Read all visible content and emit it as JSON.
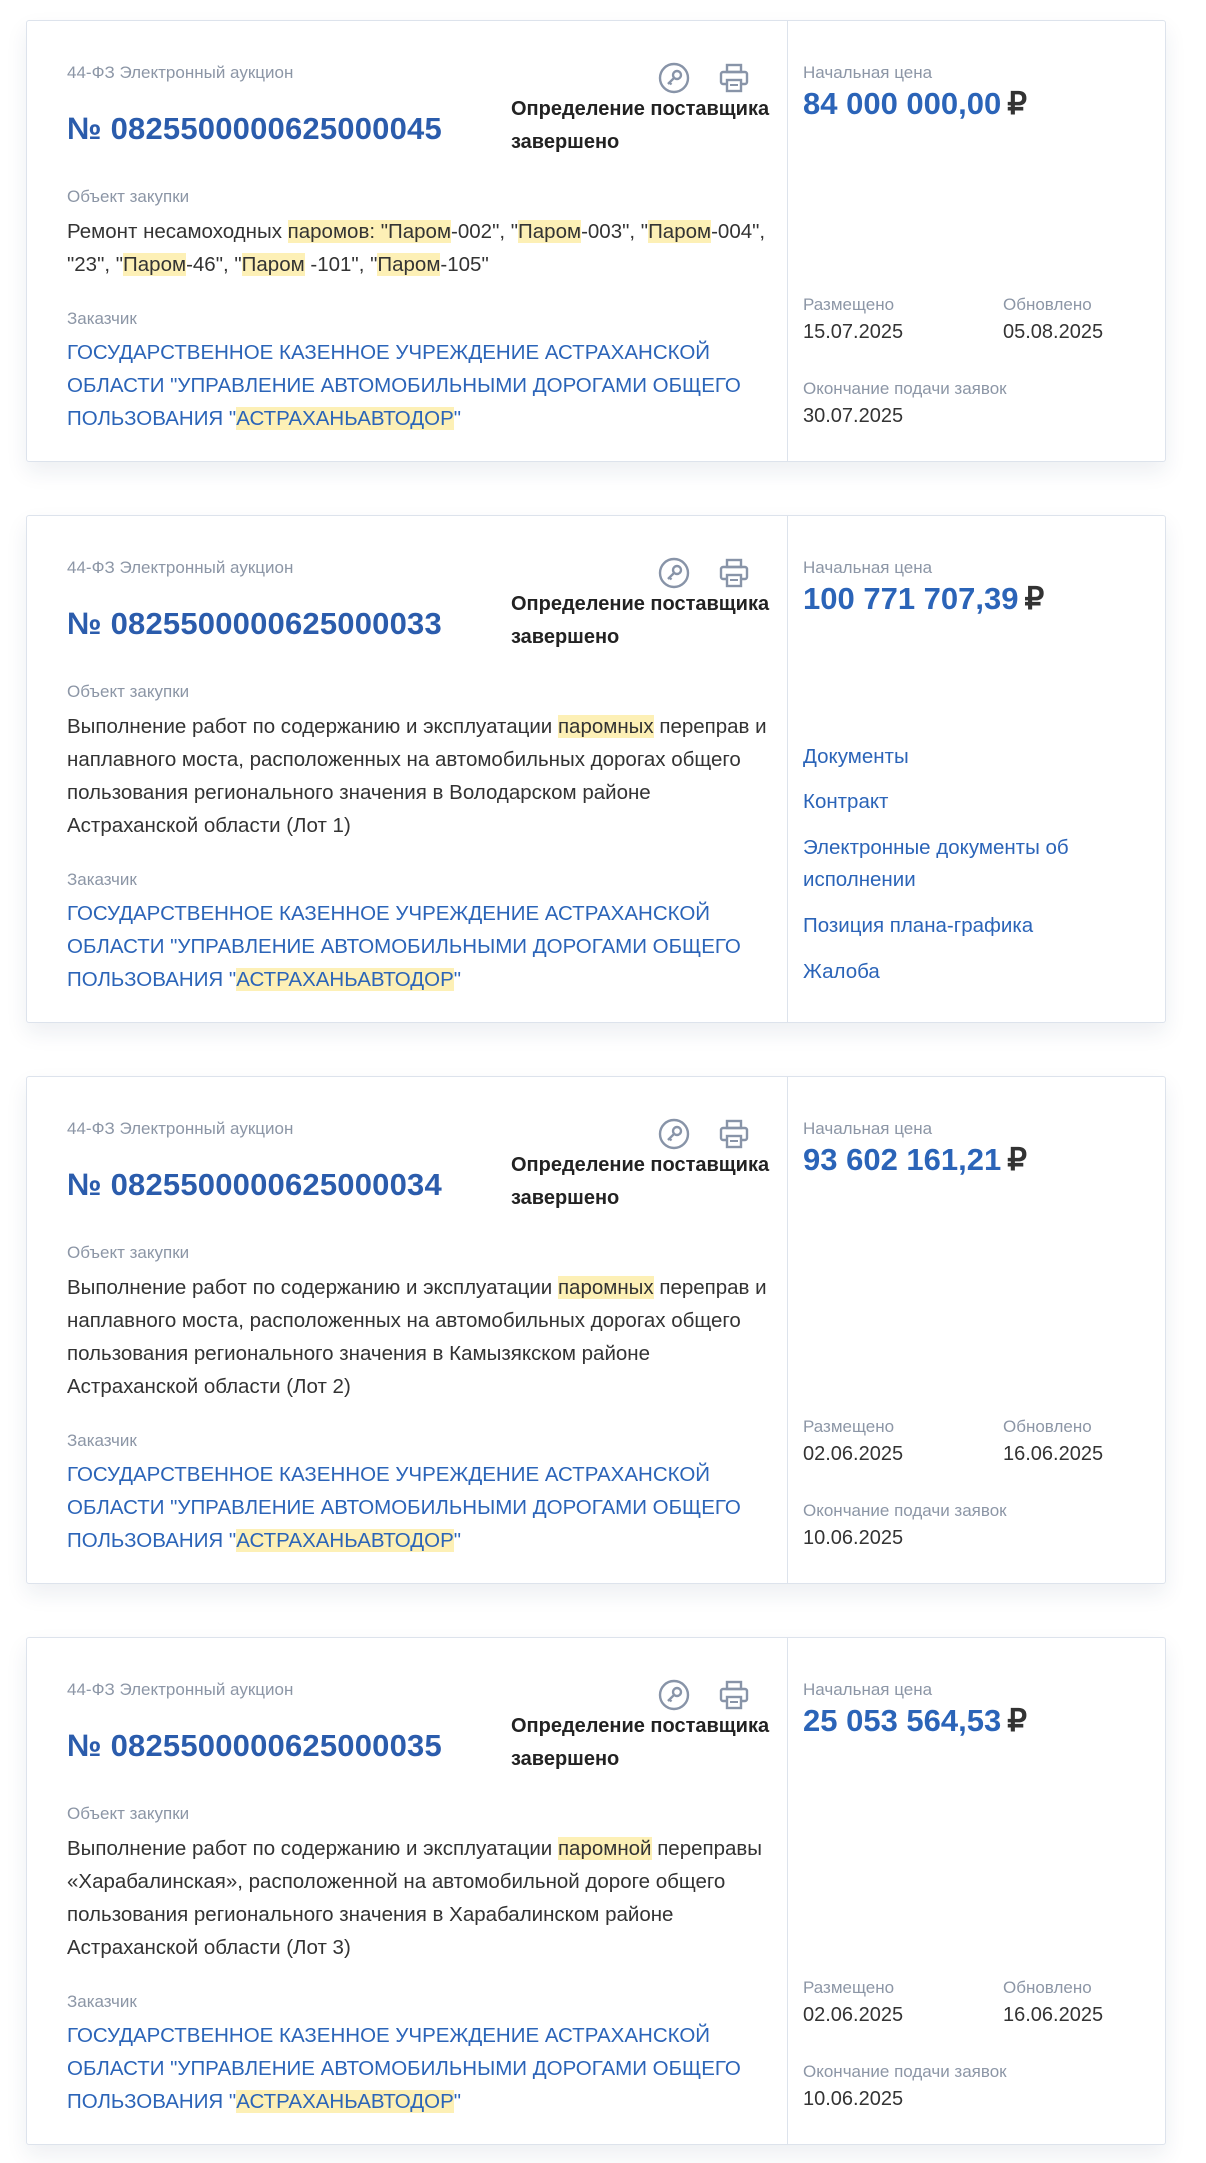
{
  "labels": {
    "object": "Объект закупки",
    "customer": "Заказчик",
    "start_price": "Начальная цена",
    "placed": "Размещено",
    "updated": "Обновлено",
    "deadline": "Окончание подачи заявок",
    "currency": "₽",
    "customer_prefix": "ГОСУДАРСТВЕННОЕ КАЗЕННОЕ УЧРЕЖДЕНИЕ АСТРАХАНСКОЙ ОБЛАСТИ \"УПРАВЛЕНИЕ АВТОМОБИЛЬНЫМИ ДОРОГАМИ ОБЩЕГО ПОЛЬЗОВАНИЯ \"",
    "customer_highlight": "АСТРАХАНЬАВТОДОР",
    "customer_suffix": "\""
  },
  "cards": [
    {
      "type": "44-ФЗ Электронный аукцион",
      "number": "№ 0825500000625000045",
      "status": "Определение поставщика завершено",
      "price": "84 000 000,00",
      "placed": "15.07.2025",
      "updated": "05.08.2025",
      "deadline": "30.07.2025",
      "object_parts": [
        {
          "t": "Ремонт несамоходных "
        },
        {
          "t": "паромов: \"Паром",
          "h": true
        },
        {
          "t": "-002\", \""
        },
        {
          "t": "Паром",
          "h": true
        },
        {
          "t": "-003\", \""
        },
        {
          "t": "Паром",
          "h": true
        },
        {
          "t": "-004\", \"23\", \""
        },
        {
          "t": "Паром",
          "h": true
        },
        {
          "t": "-46\", \""
        },
        {
          "t": "Паром",
          "h": true
        },
        {
          "t": " -101\", \""
        },
        {
          "t": "Паром",
          "h": true
        },
        {
          "t": "-105\""
        }
      ]
    },
    {
      "type": "44-ФЗ Электронный аукцион",
      "number": "№ 0825500000625000033",
      "status": "Определение поставщика завершено",
      "price": "100 771 707,39",
      "object_parts": [
        {
          "t": "Выполнение работ по содержанию и эксплуатации "
        },
        {
          "t": "паромных",
          "h": true
        },
        {
          "t": " переправ и наплавного моста, расположенных на автомобильных дорогах общего пользования регионального значения в Володарском районе Астраханской области (Лот 1)"
        }
      ],
      "links": [
        "Документы",
        "Контракт",
        "Электронные документы об исполнении",
        "Позиция плана-графика",
        "Жалоба"
      ]
    },
    {
      "type": "44-ФЗ Электронный аукцион",
      "number": "№ 0825500000625000034",
      "status": "Определение поставщика завершено",
      "price": "93 602 161,21",
      "placed": "02.06.2025",
      "updated": "16.06.2025",
      "deadline": "10.06.2025",
      "object_parts": [
        {
          "t": "Выполнение работ по содержанию и эксплуатации "
        },
        {
          "t": "паромных",
          "h": true
        },
        {
          "t": " переправ и наплавного моста, расположенных на автомобильных дорогах общего пользования регионального значения в Камызякском районе Астраханской области (Лот 2)"
        }
      ]
    },
    {
      "type": "44-ФЗ Электронный аукцион",
      "number": "№ 0825500000625000035",
      "status": "Определение поставщика завершено",
      "price": "25 053 564,53",
      "placed": "02.06.2025",
      "updated": "16.06.2025",
      "deadline": "10.06.2025",
      "object_parts": [
        {
          "t": "Выполнение работ по содержанию и эксплуатации "
        },
        {
          "t": "паромной",
          "h": true
        },
        {
          "t": " переправы «Харабалинская», расположенной на автомобильной дороге общего пользования регионального значения в Харабалинском районе Астраханской области (Лот 3)"
        }
      ]
    }
  ]
}
